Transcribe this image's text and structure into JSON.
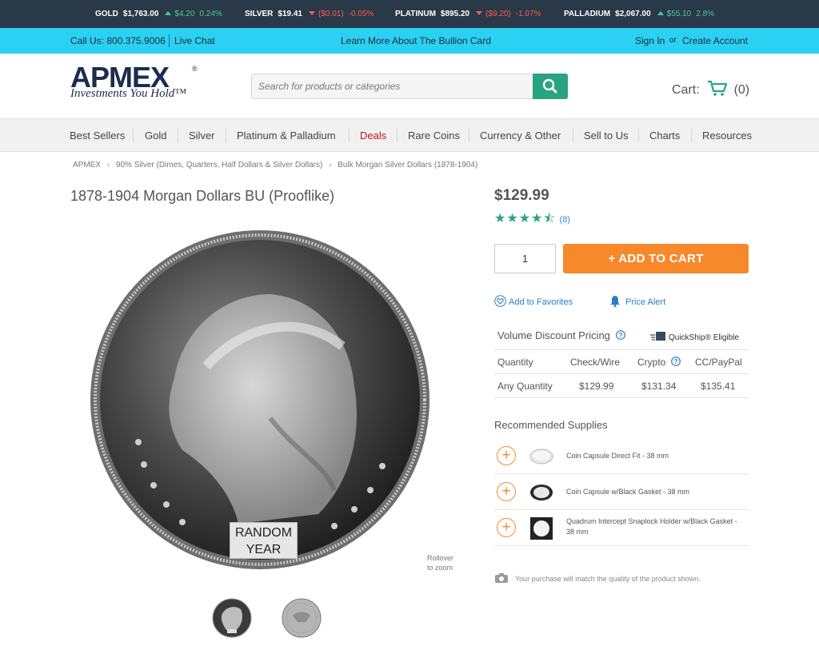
{
  "ticker": {
    "gold": {
      "label": "GOLD",
      "price": "$1,763.00",
      "change": "$4.20",
      "pct": "0.24%",
      "dir": "up"
    },
    "silver": {
      "label": "SILVER",
      "price": "$19.41",
      "change": "($0.01)",
      "pct": "-0.05%",
      "dir": "down"
    },
    "platinum": {
      "label": "PLATINUM",
      "price": "$895.20",
      "change": "($9.20)",
      "pct": "-1.07%",
      "dir": "down"
    },
    "palladium": {
      "label": "PALLADIUM",
      "price": "$2,067.00",
      "change": "$55.10",
      "pct": "2.8%",
      "dir": "up"
    }
  },
  "topbar": {
    "call_us": "Call Us:  800.375.9006",
    "live_chat": "Live Chat",
    "promo": "Learn More About The Bullion Card",
    "sign_in": "Sign In",
    "or": "or",
    "create_account": "Create Account"
  },
  "header": {
    "logo_text": "APMEX",
    "logo_reg": "®",
    "tagline": "Investments You Hold™",
    "search_placeholder": "Search for products or categories",
    "cart_label": "Cart:",
    "cart_count": "(0)"
  },
  "nav": [
    "Best Sellers",
    "Gold",
    "Silver",
    "Platinum & Palladium",
    "Deals",
    "Rare Coins",
    "Currency & Other",
    "Sell to Us",
    "Charts",
    "Resources"
  ],
  "breadcrumb": [
    "APMEX",
    "90% Silver (Dimes, Quarters, Half Dollars & Silver Dollars)",
    "Bulk Morgan Silver Dollars (1878-1904)"
  ],
  "product": {
    "title": "1878-1904 Morgan Dollars BU (Prooflike)",
    "price": "$129.99",
    "rating": 4.5,
    "stars": "★★★★⯪",
    "review_count": "(8)",
    "quantity": "1",
    "add_to_cart": "+  ADD TO CART",
    "add_to_favorites": "Add to Favorites",
    "price_alert": "Price Alert",
    "rollover": "Rollover",
    "to_zoom": "to zoom",
    "random_year_1": "RANDOM",
    "random_year_2": "YEAR"
  },
  "pricing": {
    "heading": "Volume Discount Pricing",
    "quickship": "QuickShip® Eligible",
    "columns": [
      "Quantity",
      "Check/Wire",
      "Crypto",
      "CC/PayPal"
    ],
    "rows": [
      [
        "Any Quantity",
        "$129.99",
        "$131.34",
        "$135.41"
      ]
    ]
  },
  "supplies": {
    "heading": "Recommended Supplies",
    "items": [
      "Coin Capsule Direct Fit - 38 mm",
      "Coin Capsule w/Black Gasket - 38 mm",
      "Quadrum Intercept Snaplock Holder w/Black Gasket - 38 mm"
    ]
  },
  "note": "Your purchase will match the quality of the product shown.",
  "colors": {
    "accent_orange": "#f8892b",
    "accent_green": "#2aa381",
    "topbar_cyan": "#2cd0f2",
    "ticker_bg": "#2a3947",
    "deals_red": "#c4121b"
  }
}
